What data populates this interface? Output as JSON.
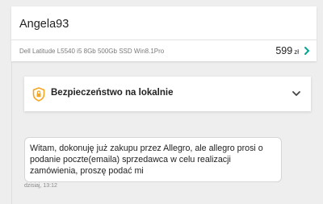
{
  "conversation": {
    "user_name": "Angela93",
    "offer": {
      "title": "Dell Latitude L5540 i5 8Gb 500Gb SSD Win8.1Pro",
      "price": "599",
      "currency": "zł",
      "chevron_icon": "chevron-right-icon"
    }
  },
  "safety": {
    "title": "Bezpieczeństwo na lokalnie",
    "icon": "shield-lock-icon",
    "icon_color": "#f5a623",
    "expand_icon": "chevron-down-icon"
  },
  "message": {
    "text": "Witam, dokonuję już zakupu przez Allegro, ale allegro prosi o podanie poczte(emaila) sprzedawca w celu realizacji zamówienia, proszę podać mi",
    "time": "dzisiaj, 13:12"
  },
  "colors": {
    "background": "#eeeeee",
    "accent_green": "#00a790",
    "accent_orange": "#f5a623"
  }
}
